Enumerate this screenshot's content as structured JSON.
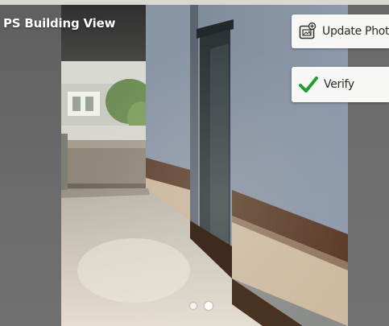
{
  "header": {
    "title": "PS Building View"
  },
  "actions": {
    "update_photo_label": "Update Photo",
    "update_photo_icon": "photo-upload-icon",
    "verify_label": "Verify",
    "verify_icon": "checkmark-icon"
  },
  "carousel": {
    "image_subject": "building corridor photo",
    "slide_count": 2,
    "active_slide": 2
  },
  "colors": {
    "check_green": "#1f9d2e",
    "button_bg": "#f7f7f5",
    "title_text": "#ffffff"
  }
}
